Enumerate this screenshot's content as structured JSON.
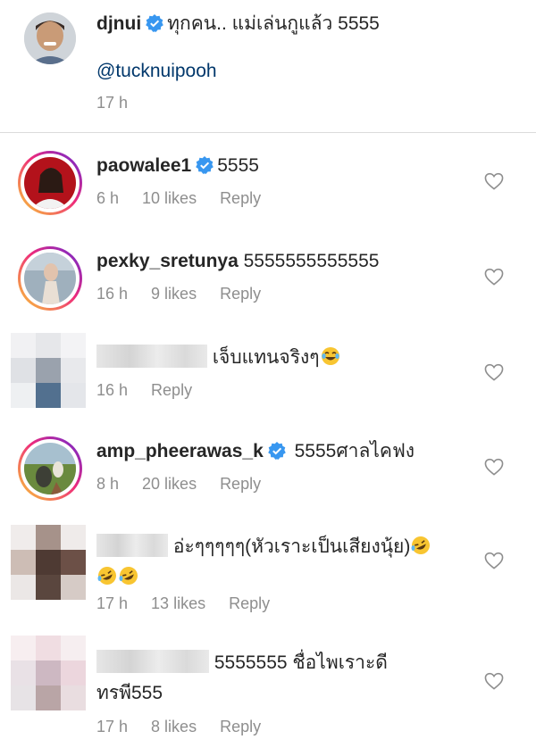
{
  "caption": {
    "username": "djnui",
    "text": "ทุกคน.. แม่เล่นกูแล้ว 5555",
    "mention": "@tucknuipooh",
    "time": "17 h"
  },
  "comments": [
    {
      "username": "paowalee1",
      "verified": true,
      "text": "5555",
      "time": "6 h",
      "likes": "10 likes",
      "reply": "Reply"
    },
    {
      "username": "pexky_sretunya",
      "verified": false,
      "text": "5555555555555",
      "time": "16 h",
      "likes": "9 likes",
      "reply": "Reply"
    },
    {
      "username": "",
      "verified": false,
      "text": "เจ็บแทนจริงๆ",
      "time": "16 h",
      "likes": "",
      "reply": "Reply",
      "emoji": "face-with-tears-of-joy"
    },
    {
      "username": "amp_pheerawas_k",
      "verified": true,
      "text": "5555ศาลไคฟง",
      "time": "8 h",
      "likes": "20 likes",
      "reply": "Reply"
    },
    {
      "username": "",
      "verified": false,
      "text": "อ่ะๆๆๆๆๆ(หัวเราะเป็นเสียงนุ้ย)",
      "time": "17 h",
      "likes": "13 likes",
      "reply": "Reply",
      "emoji": "rolling-on-floor-laughing"
    },
    {
      "username": "",
      "verified": false,
      "text": "5555555 ชื่อไพเราะดี",
      "text2": "ทรพี555",
      "time": "17 h",
      "likes": "8 likes",
      "reply": "Reply"
    }
  ],
  "colors": {
    "verified": "#3897f0",
    "link": "#00376b",
    "meta": "#8e8e8e",
    "story_ring": [
      "#f9ce34",
      "#ee2a7b",
      "#6228d7"
    ]
  }
}
